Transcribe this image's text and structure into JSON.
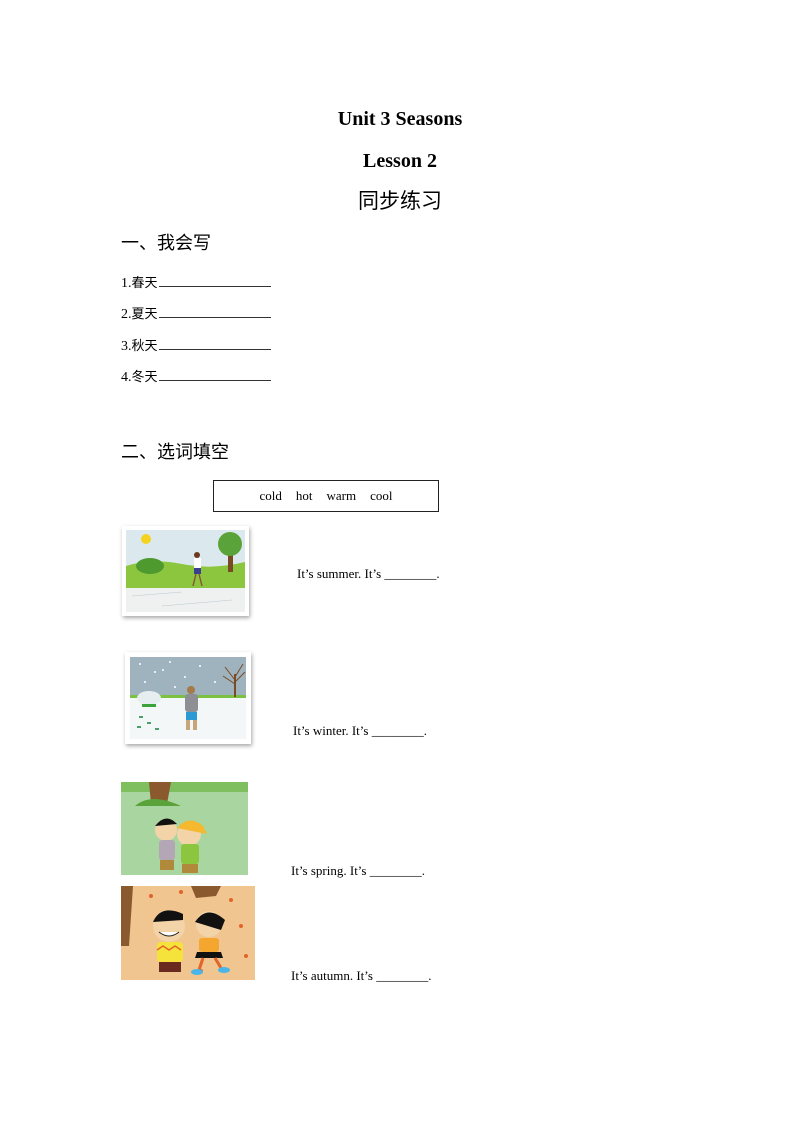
{
  "header": {
    "title": "Unit 3 Seasons",
    "lesson": "Lesson 2",
    "subtitle": "同步练习"
  },
  "section1": {
    "heading": "一、我会写",
    "items": [
      {
        "num": "1.",
        "word": "春天"
      },
      {
        "num": "2.",
        "word": "夏天"
      },
      {
        "num": "3.",
        "word": "秋天"
      },
      {
        "num": "4.",
        "word": "冬天"
      }
    ]
  },
  "section2": {
    "heading": "二、选词填空",
    "word_bank": [
      "cold",
      "hot",
      "warm",
      "cool"
    ],
    "questions": [
      {
        "sentence": "It’s summer. It’s ________.",
        "image": "summer-scene-image"
      },
      {
        "sentence": "It’s winter. It’s ________.",
        "image": "winter-scene-image"
      },
      {
        "sentence": "It’s spring. It’s ________.",
        "image": "spring-scene-image"
      },
      {
        "sentence": "It’s autumn. It’s ________.",
        "image": "autumn-scene-image"
      }
    ]
  }
}
